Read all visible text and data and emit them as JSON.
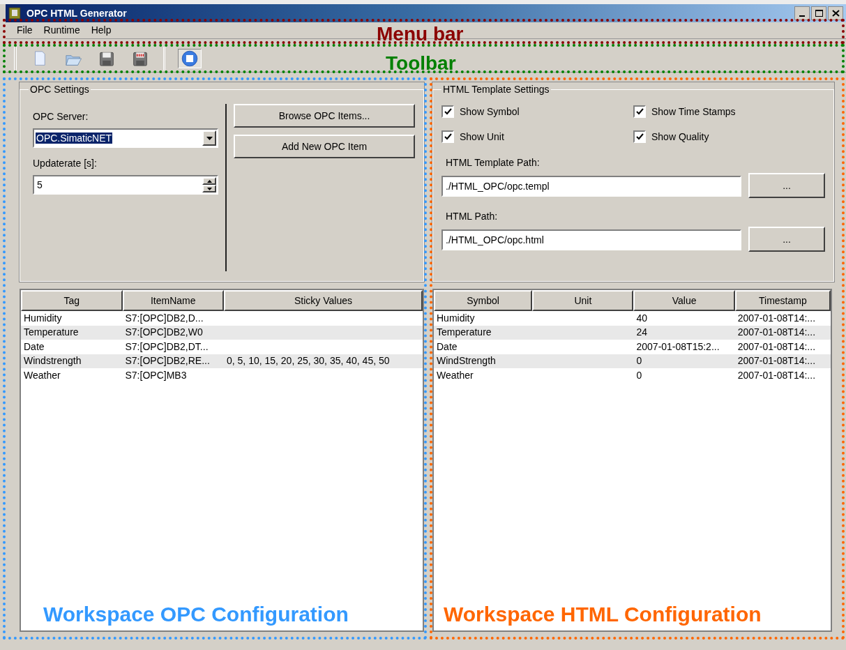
{
  "window": {
    "title": "OPC HTML Generator"
  },
  "menu_bar": {
    "items": [
      "File",
      "Runtime",
      "Help"
    ]
  },
  "toolbar": {
    "items": [
      {
        "kind": "new"
      },
      {
        "kind": "open"
      },
      {
        "kind": "save"
      },
      {
        "kind": "save-html"
      },
      {
        "kind": "separator"
      },
      {
        "kind": "stop",
        "pressed": true
      }
    ]
  },
  "opc_settings": {
    "title": "OPC Settings",
    "server_label": "OPC Server:",
    "server_value": "OPC.SimaticNET",
    "server_highlighted": true,
    "rate_label": "Updaterate [s]:",
    "rate_value": "5",
    "buttons": [
      "Browse OPC Items...",
      "Add New OPC Item"
    ]
  },
  "html_settings": {
    "title": "HTML Template Settings",
    "checkboxes": [
      {
        "label": "Show Symbol",
        "checked": true
      },
      {
        "label": "Show Time Stamps",
        "checked": true
      },
      {
        "label": "Show Unit",
        "checked": true
      },
      {
        "label": "Show Quality",
        "checked": true
      }
    ],
    "paths": [
      {
        "label": "HTML Template Path:",
        "value": "./HTML_OPC/opc.templ",
        "button": "..."
      },
      {
        "label": "HTML Path:",
        "value": "./HTML_OPC/opc.html",
        "button": "..."
      }
    ]
  },
  "opc_table": {
    "columns": [
      "Tag",
      "ItemName",
      "Sticky Values"
    ],
    "rows": [
      [
        "Humidity",
        "S7:[OPC]DB2,D...",
        ""
      ],
      [
        "Temperature",
        "S7:[OPC]DB2,W0",
        ""
      ],
      [
        "Date",
        "S7:[OPC]DB2,DT...",
        ""
      ],
      [
        "Windstrength",
        "S7:[OPC]DB2,RE...",
        "0, 5, 10, 15, 20, 25, 30, 35, 40, 45, 50"
      ],
      [
        "Weather",
        "S7:[OPC]MB3",
        ""
      ]
    ]
  },
  "html_table": {
    "columns": [
      "Symbol",
      "Unit",
      "Value",
      "Timestamp"
    ],
    "rows": [
      [
        "Humidity",
        "",
        "40",
        "2007-01-08T14:..."
      ],
      [
        "Temperature",
        "",
        "24",
        "2007-01-08T14:..."
      ],
      [
        "Date",
        "",
        "2007-01-08T15:2...",
        "2007-01-08T14:..."
      ],
      [
        "WindStrength",
        "",
        "0",
        "2007-01-08T14:..."
      ],
      [
        "Weather",
        "",
        "0",
        "2007-01-08T14:..."
      ]
    ]
  },
  "annotations": [
    {
      "label": "Menu bar",
      "color": "#8b0000",
      "kind": "menu"
    },
    {
      "label": "Toolbar",
      "color": "#008000",
      "kind": "toolbar"
    },
    {
      "label": "Workspace OPC Configuration",
      "color": "#3399ff",
      "kind": "left"
    },
    {
      "label": "Workspace HTML Configuration",
      "color": "#ff6600",
      "kind": "right"
    }
  ]
}
